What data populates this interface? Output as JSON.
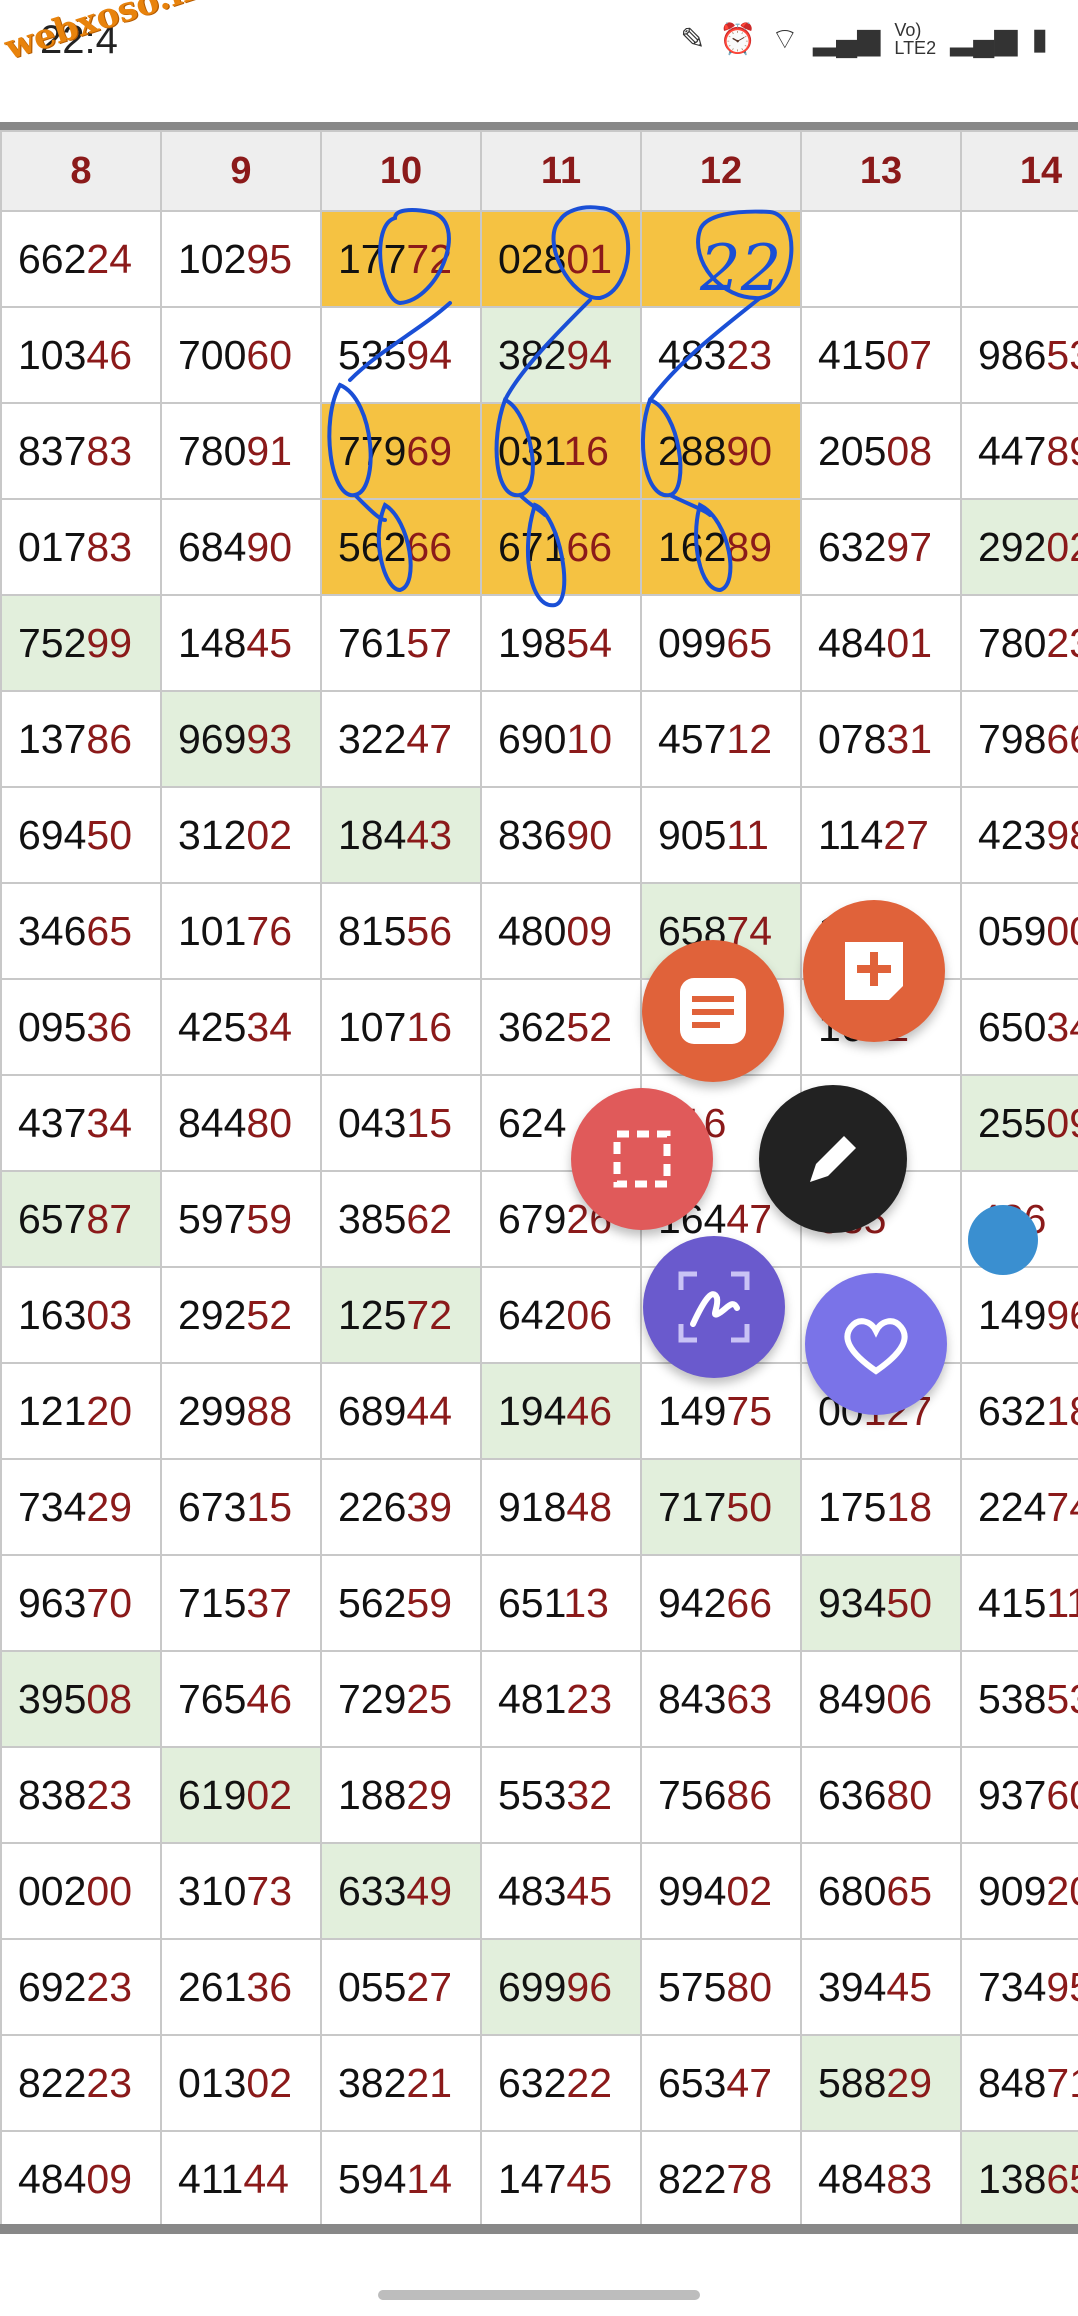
{
  "status": {
    "time": "22:4",
    "icons": [
      "pen-icon",
      "alarm-icon",
      "wifi-icon",
      "signal-icon",
      "volte-icon",
      "signal2-icon",
      "battery-icon"
    ]
  },
  "watermark": "webxoso.net",
  "table": {
    "headers": [
      "8",
      "9",
      "10",
      "11",
      "12",
      "13",
      "14"
    ],
    "rows": [
      [
        [
          "662",
          "24"
        ],
        [
          "102",
          "95"
        ],
        [
          "177",
          "72"
        ],
        [
          "028",
          "01"
        ],
        [
          "",
          ""
        ],
        [
          "",
          ""
        ],
        [
          "",
          ""
        ]
      ],
      [
        [
          "103",
          "46"
        ],
        [
          "700",
          "60"
        ],
        [
          "535",
          "94"
        ],
        [
          "382",
          "94"
        ],
        [
          "483",
          "23"
        ],
        [
          "415",
          "07"
        ],
        [
          "986",
          "53"
        ]
      ],
      [
        [
          "837",
          "83"
        ],
        [
          "780",
          "91"
        ],
        [
          "779",
          "69"
        ],
        [
          "031",
          "16"
        ],
        [
          "288",
          "90"
        ],
        [
          "205",
          "08"
        ],
        [
          "447",
          "89"
        ]
      ],
      [
        [
          "017",
          "83"
        ],
        [
          "684",
          "90"
        ],
        [
          "562",
          "66"
        ],
        [
          "671",
          "66"
        ],
        [
          "162",
          "89"
        ],
        [
          "632",
          "97"
        ],
        [
          "292",
          "02"
        ]
      ],
      [
        [
          "752",
          "99"
        ],
        [
          "148",
          "45"
        ],
        [
          "761",
          "57"
        ],
        [
          "198",
          "54"
        ],
        [
          "099",
          "65"
        ],
        [
          "484",
          "01"
        ],
        [
          "780",
          "23"
        ]
      ],
      [
        [
          "137",
          "86"
        ],
        [
          "969",
          "93"
        ],
        [
          "322",
          "47"
        ],
        [
          "690",
          "10"
        ],
        [
          "457",
          "12"
        ],
        [
          "078",
          "31"
        ],
        [
          "798",
          "66"
        ]
      ],
      [
        [
          "694",
          "50"
        ],
        [
          "312",
          "02"
        ],
        [
          "184",
          "43"
        ],
        [
          "836",
          "90"
        ],
        [
          "905",
          "11"
        ],
        [
          "114",
          "27"
        ],
        [
          "423",
          "98"
        ]
      ],
      [
        [
          "346",
          "65"
        ],
        [
          "101",
          "76"
        ],
        [
          "815",
          "56"
        ],
        [
          "480",
          "09"
        ],
        [
          "658",
          "74"
        ],
        [
          "1",
          ""
        ],
        [
          "059",
          "00"
        ]
      ],
      [
        [
          "095",
          "36"
        ],
        [
          "425",
          "34"
        ],
        [
          "107",
          "16"
        ],
        [
          "362",
          "52"
        ],
        [
          "",
          ""
        ],
        [
          "16",
          "92"
        ],
        [
          "650",
          "34"
        ]
      ],
      [
        [
          "437",
          "34"
        ],
        [
          "844",
          "80"
        ],
        [
          "043",
          "15"
        ],
        [
          "624",
          ""
        ],
        [
          "",
          "316"
        ],
        [
          "",
          "48"
        ],
        [
          "255",
          "09"
        ]
      ],
      [
        [
          "657",
          "87"
        ],
        [
          "597",
          "59"
        ],
        [
          "385",
          "62"
        ],
        [
          "679",
          "26"
        ],
        [
          "164",
          "47"
        ],
        [
          "",
          "535"
        ],
        [
          "",
          "486"
        ]
      ],
      [
        [
          "163",
          "03"
        ],
        [
          "292",
          "52"
        ],
        [
          "125",
          "72"
        ],
        [
          "642",
          "06"
        ],
        [
          "",
          ""
        ],
        [
          "",
          ""
        ],
        [
          "149",
          "96"
        ]
      ],
      [
        [
          "121",
          "20"
        ],
        [
          "299",
          "88"
        ],
        [
          "689",
          "44"
        ],
        [
          "194",
          "46"
        ],
        [
          "149",
          "75"
        ],
        [
          "00",
          "127"
        ],
        [
          "632",
          "18"
        ]
      ],
      [
        [
          "734",
          "29"
        ],
        [
          "673",
          "15"
        ],
        [
          "226",
          "39"
        ],
        [
          "918",
          "48"
        ],
        [
          "717",
          "50"
        ],
        [
          "175",
          "18"
        ],
        [
          "224",
          "74"
        ]
      ],
      [
        [
          "963",
          "70"
        ],
        [
          "715",
          "37"
        ],
        [
          "562",
          "59"
        ],
        [
          "651",
          "13"
        ],
        [
          "942",
          "66"
        ],
        [
          "934",
          "50"
        ],
        [
          "415",
          "11"
        ]
      ],
      [
        [
          "395",
          "08"
        ],
        [
          "765",
          "46"
        ],
        [
          "729",
          "25"
        ],
        [
          "481",
          "23"
        ],
        [
          "843",
          "63"
        ],
        [
          "849",
          "06"
        ],
        [
          "538",
          "53"
        ]
      ],
      [
        [
          "838",
          "23"
        ],
        [
          "619",
          "02"
        ],
        [
          "188",
          "29"
        ],
        [
          "553",
          "32"
        ],
        [
          "756",
          "86"
        ],
        [
          "636",
          "80"
        ],
        [
          "937",
          "60"
        ]
      ],
      [
        [
          "002",
          "00"
        ],
        [
          "310",
          "73"
        ],
        [
          "633",
          "49"
        ],
        [
          "483",
          "45"
        ],
        [
          "994",
          "02"
        ],
        [
          "680",
          "65"
        ],
        [
          "909",
          "20"
        ]
      ],
      [
        [
          "692",
          "23"
        ],
        [
          "261",
          "36"
        ],
        [
          "055",
          "27"
        ],
        [
          "699",
          "96"
        ],
        [
          "575",
          "80"
        ],
        [
          "394",
          "45"
        ],
        [
          "734",
          "95"
        ]
      ],
      [
        [
          "822",
          "23"
        ],
        [
          "013",
          "02"
        ],
        [
          "382",
          "21"
        ],
        [
          "632",
          "22"
        ],
        [
          "653",
          "47"
        ],
        [
          "588",
          "29"
        ],
        [
          "848",
          "71"
        ]
      ],
      [
        [
          "484",
          "09"
        ],
        [
          "411",
          "44"
        ],
        [
          "594",
          "14"
        ],
        [
          "147",
          "45"
        ],
        [
          "822",
          "78"
        ],
        [
          "484",
          "83"
        ],
        [
          "138",
          "65"
        ]
      ]
    ],
    "highlights": {
      "green": [
        "4-0",
        "5-1",
        "6-2",
        "7-4",
        "9-6",
        "10-0",
        "11-2",
        "12-3",
        "13-4",
        "14-5",
        "15-0",
        "16-1",
        "17-2",
        "18-3",
        "19-5",
        "20-6",
        "3-6",
        "1-3"
      ],
      "orange": [
        "0-2",
        "0-3",
        "0-4",
        "2-2",
        "2-3",
        "2-4",
        "3-2",
        "3-3",
        "3-4"
      ]
    }
  },
  "handwriting": {
    "text": "22",
    "color": "#1a4fd6"
  },
  "fabs": {
    "colors": {
      "notes": "#e0623a",
      "new_note": "#e0623a",
      "screenshot": "#e05a5a",
      "pen": "#222222",
      "write": "#6a5acd",
      "favorite": "#7a73e8",
      "dot": "#3a8fd0"
    }
  }
}
